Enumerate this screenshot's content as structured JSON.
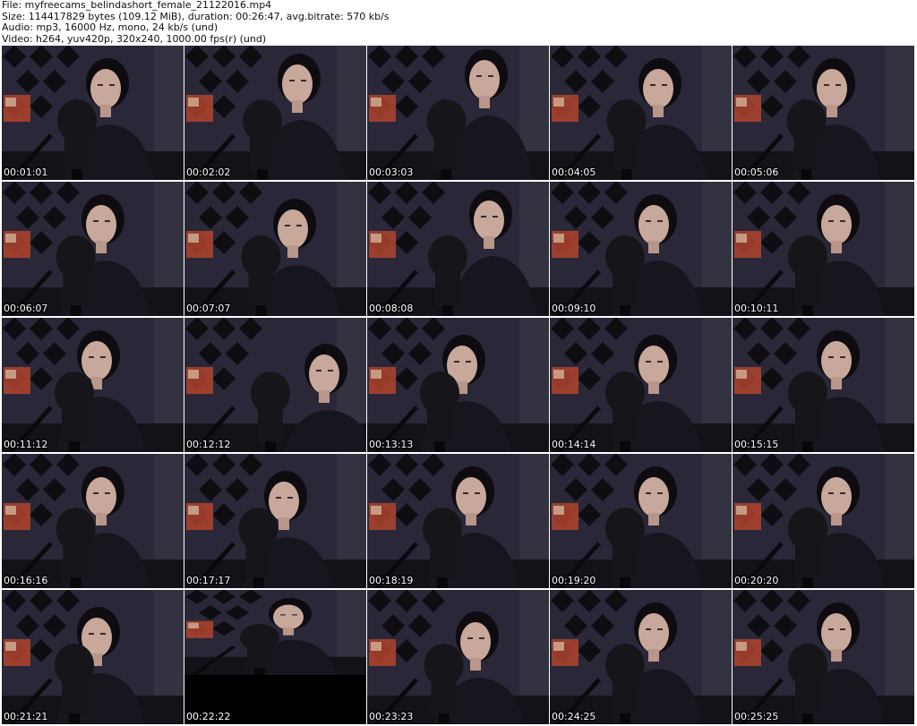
{
  "header": {
    "file_line": "File: myfreecams_belindashort_female_21122016.mp4",
    "size_line": "Size: 114417829 bytes (109.12 MiB), duration: 00:26:47, avg.bitrate: 570 kb/s",
    "audio_line": "Audio: mp3, 16000 Hz, mono, 24 kb/s (und)",
    "video_line": "Video: h264, yuv420p, 320x240, 1000.00 fps(r) (und)"
  },
  "thumbnails": [
    {
      "timestamp": "00:01:01"
    },
    {
      "timestamp": "00:02:02"
    },
    {
      "timestamp": "00:03:03"
    },
    {
      "timestamp": "00:04:05"
    },
    {
      "timestamp": "00:05:06"
    },
    {
      "timestamp": "00:06:07"
    },
    {
      "timestamp": "00:07:07"
    },
    {
      "timestamp": "00:08:08"
    },
    {
      "timestamp": "00:09:10"
    },
    {
      "timestamp": "00:10:11"
    },
    {
      "timestamp": "00:11:12"
    },
    {
      "timestamp": "00:12:12"
    },
    {
      "timestamp": "00:13:13"
    },
    {
      "timestamp": "00:14:14"
    },
    {
      "timestamp": "00:15:15"
    },
    {
      "timestamp": "00:16:16"
    },
    {
      "timestamp": "00:17:17"
    },
    {
      "timestamp": "00:18:19"
    },
    {
      "timestamp": "00:19:20"
    },
    {
      "timestamp": "00:20:20"
    },
    {
      "timestamp": "00:21:21"
    },
    {
      "timestamp": "00:22:22"
    },
    {
      "timestamp": "00:23:23"
    },
    {
      "timestamp": "00:24:25"
    },
    {
      "timestamp": "00:25:25"
    }
  ],
  "colors": {
    "wall": "#2a2838",
    "diamond": "#0d0d12",
    "skin": "#c8a89a",
    "mic": "#15151a",
    "poster": "#b0432e",
    "text_overlay": "#ffffff"
  }
}
